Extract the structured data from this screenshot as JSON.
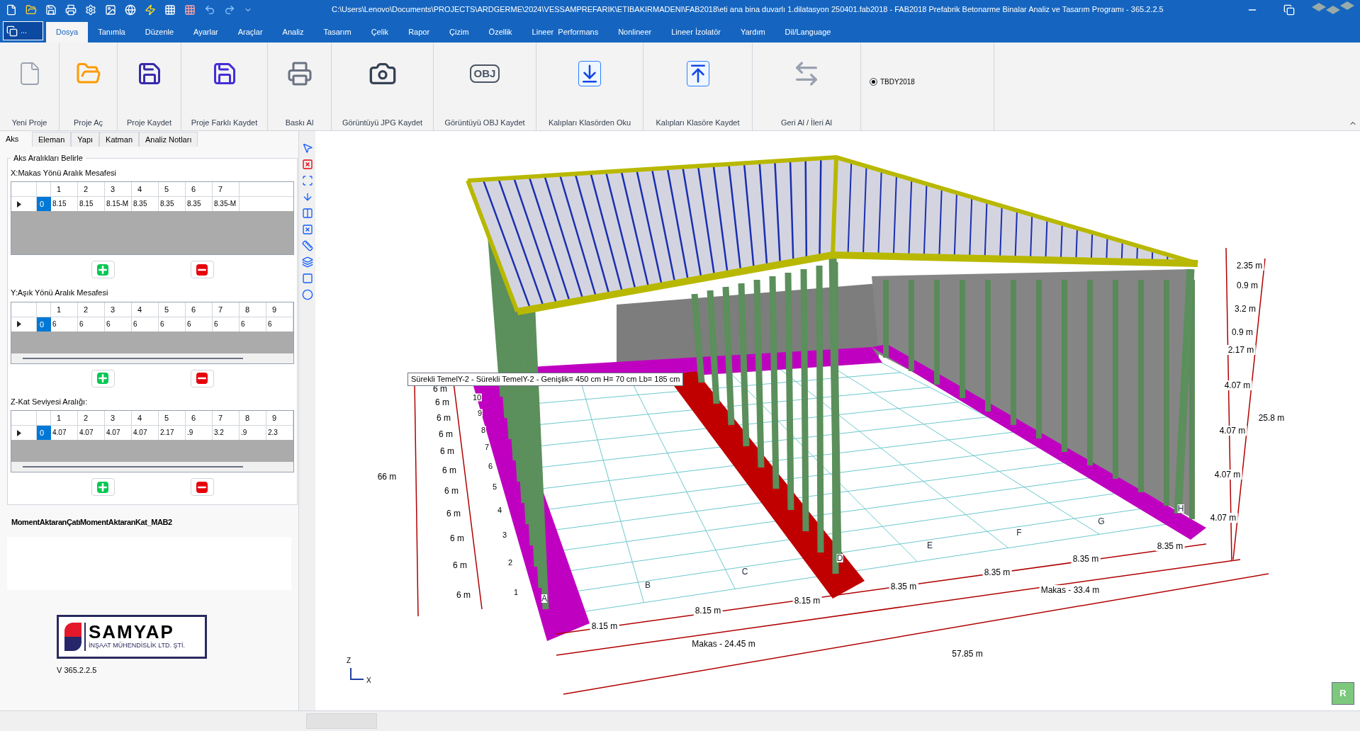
{
  "window": {
    "title": "C:\\Users\\Lenovo\\Documents\\PROJECTS\\ARDGERME\\2024\\VESSAMPREFARIK\\ETIBAKIRMADENI\\FAB2018\\eti  ana bina duvarlı 1.dilatasyon 250401.fab2018 - FAB2018 Prefabrik Betonarme Binalar Analiz ve Tasarım Programı - 365.2.2.5"
  },
  "app_button": {
    "label": "..."
  },
  "menu": [
    {
      "label": "Dosya",
      "selected": true
    },
    {
      "label": "Tanımla",
      "selected": false
    },
    {
      "label": "Düzenle",
      "selected": false
    },
    {
      "label": "Ayarlar",
      "selected": false
    },
    {
      "label": "Araçlar",
      "selected": false
    },
    {
      "label": "Analiz",
      "selected": false
    },
    {
      "label": "Tasarım",
      "selected": false
    },
    {
      "label": "Çelik",
      "selected": false
    },
    {
      "label": "Rapor",
      "selected": false
    },
    {
      "label": "Çizim",
      "selected": false
    },
    {
      "label": "Özellik",
      "selected": false
    },
    {
      "label": "Lineer  Performans",
      "selected": false
    },
    {
      "label": "Nonlineer",
      "selected": false
    },
    {
      "label": "Lineer İzolatör",
      "selected": false
    },
    {
      "label": "Yardım",
      "selected": false
    },
    {
      "label": "Dil/Language",
      "selected": false
    }
  ],
  "ribbon": {
    "groups": [
      {
        "kind": "new",
        "label": "Yeni Proje"
      },
      {
        "kind": "open",
        "label": "Proje Aç"
      },
      {
        "kind": "save",
        "label": "Proje Kaydet"
      },
      {
        "kind": "saveas",
        "label": "Proje Farklı Kaydet"
      },
      {
        "kind": "print",
        "label": "Baskı Al"
      },
      {
        "kind": "camera",
        "label": "Görüntüyü JPG Kaydet"
      },
      {
        "kind": "obj",
        "label": "Görüntüyü OBJ Kaydet",
        "icon_text": "OBJ"
      },
      {
        "kind": "import",
        "label": "Kalıpları Klasörden Oku"
      },
      {
        "kind": "export",
        "label": "Kalıpları Klasöre Kaydet"
      },
      {
        "kind": "undo",
        "label": "Geri Al / İleri Al"
      }
    ],
    "code": {
      "label": "TBDY2018",
      "selected": true
    }
  },
  "panel": {
    "tabs": [
      {
        "label": "Aks",
        "selected": true
      },
      {
        "label": "Eleman",
        "selected": false
      },
      {
        "label": "Yapı",
        "selected": false
      },
      {
        "label": "Katman",
        "selected": false
      },
      {
        "label": "Analiz Notları",
        "selected": false
      }
    ],
    "group_title": "Aks Aralıkları Belirle",
    "grids": [
      {
        "title": "X:Makas Yönü Aralık Mesafesi",
        "scrollbar": false,
        "columns": [
          "1",
          "2",
          "3",
          "4",
          "5",
          "6",
          "7"
        ],
        "row": {
          "index": "0",
          "selected": true,
          "values": [
            "8.15",
            "8.15",
            "8.15-M",
            "8.35",
            "8.35",
            "8.35",
            "8.35-M"
          ]
        }
      },
      {
        "title": "Y:Aşık Yönü Aralık Mesafesi",
        "scrollbar": true,
        "columns": [
          "1",
          "2",
          "3",
          "4",
          "5",
          "6",
          "7",
          "8",
          "9"
        ],
        "row": {
          "index": "0",
          "selected": true,
          "values": [
            "6",
            "6",
            "6",
            "6",
            "6",
            "6",
            "6",
            "6",
            "6"
          ]
        }
      },
      {
        "title": "Z-Kat Seviyesi Aralığı:",
        "scrollbar": true,
        "columns": [
          "1",
          "2",
          "3",
          "4",
          "5",
          "6",
          "7",
          "8",
          "9"
        ],
        "row": {
          "index": "0",
          "selected": true,
          "values": [
            "4.07",
            "4.07",
            "4.07",
            "4.07",
            "2.17",
            ".9",
            "3.2",
            ".9",
            "2.3"
          ]
        }
      }
    ],
    "model_name": "MomentAktaranÇatıMomentAktaranKat_MAB2",
    "logo": {
      "name": "SAMYAP",
      "subtitle": "İNŞAAT MÜHENDİSLİK LTD. ŞTİ."
    },
    "version": "V 365.2.2.5"
  },
  "viewport": {
    "tooltip": "Sürekli TemelY-2 - Sürekli TemelY-2 - Genişlik= 450 cm H= 70 cm Lb= 185 cm",
    "labels": [
      {
        "kind": "axis",
        "text": "A"
      },
      {
        "kind": "axis",
        "text": "B"
      },
      {
        "kind": "axis",
        "text": "C"
      },
      {
        "kind": "axis",
        "text": "D"
      },
      {
        "kind": "axis",
        "text": "E"
      },
      {
        "kind": "axis",
        "text": "F"
      },
      {
        "kind": "axis",
        "text": "G"
      },
      {
        "kind": "axis",
        "text": "H"
      },
      {
        "kind": "row",
        "text": "10"
      },
      {
        "kind": "row",
        "text": "9"
      },
      {
        "kind": "row",
        "text": "8"
      },
      {
        "kind": "row",
        "text": "7"
      },
      {
        "kind": "row",
        "text": "6"
      },
      {
        "kind": "row",
        "text": "5"
      },
      {
        "kind": "row",
        "text": "4"
      },
      {
        "kind": "row",
        "text": "3"
      },
      {
        "kind": "row",
        "text": "2"
      },
      {
        "kind": "row",
        "text": "1"
      },
      {
        "kind": "dim",
        "text": "6 m"
      },
      {
        "kind": "dim",
        "text": "6 m"
      },
      {
        "kind": "dim",
        "text": "6 m"
      },
      {
        "kind": "dim",
        "text": "6 m"
      },
      {
        "kind": "dim",
        "text": "6 m"
      },
      {
        "kind": "dim",
        "text": "6 m"
      },
      {
        "kind": "dim",
        "text": "6 m"
      },
      {
        "kind": "dim",
        "text": "6 m"
      },
      {
        "kind": "dim",
        "text": "6 m"
      },
      {
        "kind": "dim",
        "text": "6 m"
      },
      {
        "kind": "dim",
        "text": "6 m"
      },
      {
        "kind": "dim",
        "text": "66 m"
      },
      {
        "kind": "dim",
        "text": "8.15 m"
      },
      {
        "kind": "dim",
        "text": "8.15 m"
      },
      {
        "kind": "dim",
        "text": "8.15 m"
      },
      {
        "kind": "dim",
        "text": "8.35 m"
      },
      {
        "kind": "dim",
        "text": "8.35 m"
      },
      {
        "kind": "dim",
        "text": "8.35 m"
      },
      {
        "kind": "dim",
        "text": "8.35 m"
      },
      {
        "kind": "dim",
        "text": "Makas - 24.45 m"
      },
      {
        "kind": "dim",
        "text": "Makas - 33.4 m"
      },
      {
        "kind": "dim",
        "text": "57.85 m"
      },
      {
        "kind": "dim",
        "text": "2.35 m"
      },
      {
        "kind": "dim",
        "text": "0.9 m"
      },
      {
        "kind": "dim",
        "text": "3.2 m"
      },
      {
        "kind": "dim",
        "text": "0.9 m"
      },
      {
        "kind": "dim",
        "text": "2.17 m"
      },
      {
        "kind": "dim",
        "text": "4.07 m"
      },
      {
        "kind": "dim",
        "text": "4.07 m"
      },
      {
        "kind": "dim",
        "text": "4.07 m"
      },
      {
        "kind": "dim",
        "text": "4.07 m"
      },
      {
        "kind": "dim",
        "text": "25.8 m"
      }
    ],
    "gizmo": {
      "z": "Z",
      "x": "X"
    },
    "view_cube": {
      "label": "R"
    }
  }
}
